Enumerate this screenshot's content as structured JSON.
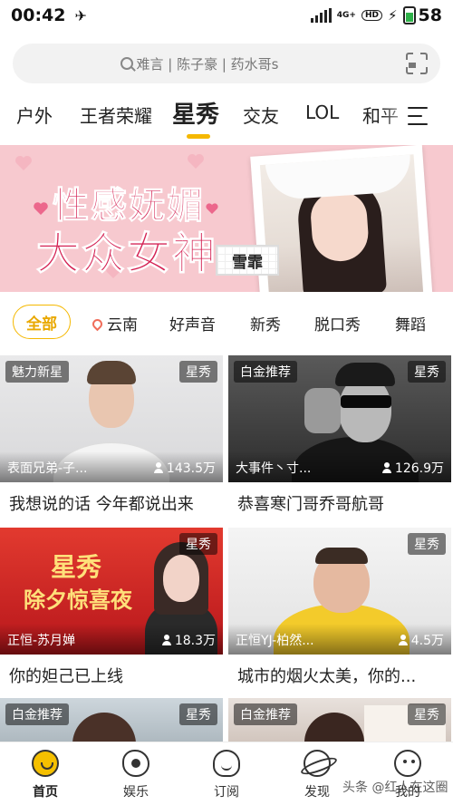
{
  "status_bar": {
    "time": "00:42",
    "network": "4G+",
    "hd": "HD",
    "battery": "58"
  },
  "search": {
    "placeholder": "难言 | 陈子豪 | 药水哥s"
  },
  "tabs": [
    "户外",
    "王者荣耀",
    "星秀",
    "交友",
    "LOL",
    "和平"
  ],
  "banner": {
    "line1": "性感妩媚",
    "line2": "大众女神",
    "name": "雪霏"
  },
  "filters": [
    "全部",
    "云南",
    "好声音",
    "新秀",
    "脱口秀",
    "舞蹈"
  ],
  "cards": [
    {
      "tag": "魅力新星",
      "category": "星秀",
      "anchor": "表面兄弟-子...",
      "viewers": "143.5万",
      "title": "我想说的话 今年都说出来"
    },
    {
      "tag": "白金推荐",
      "category": "星秀",
      "anchor": "大事件丶寸...",
      "viewers": "126.9万",
      "title": "恭喜寒门哥乔哥航哥"
    },
    {
      "tag": "",
      "category": "星秀",
      "anchor": "正恒-苏月婵",
      "viewers": "18.3万",
      "title": "你的妲己已上线",
      "poster_text": [
        "星秀",
        "除夕惊喜夜"
      ]
    },
    {
      "tag": "",
      "category": "星秀",
      "anchor": "正恒YJ-柏然...",
      "viewers": "4.5万",
      "title": "城市的烟火太美，你的..."
    },
    {
      "tag": "白金推荐",
      "category": "星秀",
      "anchor": "",
      "viewers": "",
      "title": ""
    },
    {
      "tag": "白金推荐",
      "category": "星秀",
      "anchor": "",
      "viewers": "",
      "title": ""
    }
  ],
  "bottom_nav": [
    "首页",
    "娱乐",
    "订阅",
    "发现",
    "我的"
  ],
  "watermark": "头条 @红人在这圈",
  "colors": {
    "accent": "#f5b800",
    "banner_bg": "#f7c9cf",
    "headline": "#d42052"
  }
}
